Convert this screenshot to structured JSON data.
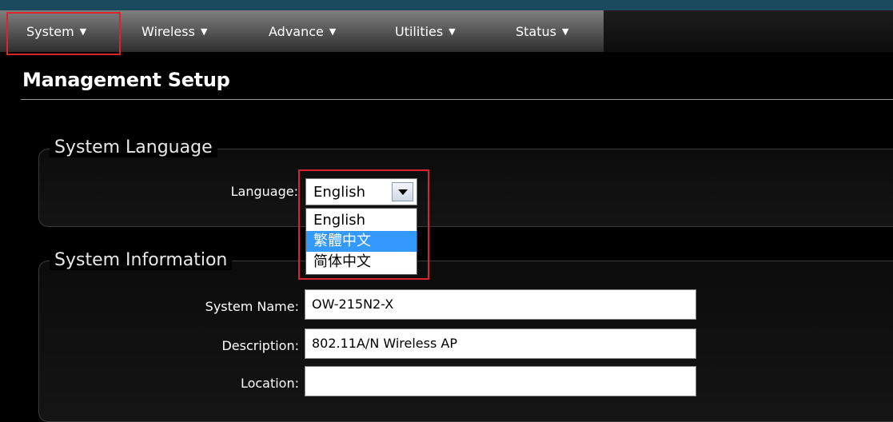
{
  "nav": {
    "items": [
      {
        "label": "System",
        "caret": "▼"
      },
      {
        "label": "Wireless",
        "caret": "▼"
      },
      {
        "label": "Advance",
        "caret": "▼"
      },
      {
        "label": "Utilities",
        "caret": "▼"
      },
      {
        "label": "Status",
        "caret": "▼"
      }
    ]
  },
  "page": {
    "title": "Management Setup"
  },
  "language_section": {
    "legend": "System Language",
    "label": "Language:",
    "selected": "English",
    "options": [
      "English",
      "繁體中文",
      "简体中文"
    ],
    "highlighted_option": "繁體中文"
  },
  "info_section": {
    "legend": "System Information",
    "fields": [
      {
        "label": "System Name:",
        "value": "OW-215N2-X"
      },
      {
        "label": "Description:",
        "value": "802.11A/N Wireless AP"
      },
      {
        "label": "Location:",
        "value": ""
      }
    ]
  },
  "colors": {
    "annotation": "#d8242f",
    "option_highlight": "#3399ff",
    "top_strip": "#1b4a5e"
  }
}
